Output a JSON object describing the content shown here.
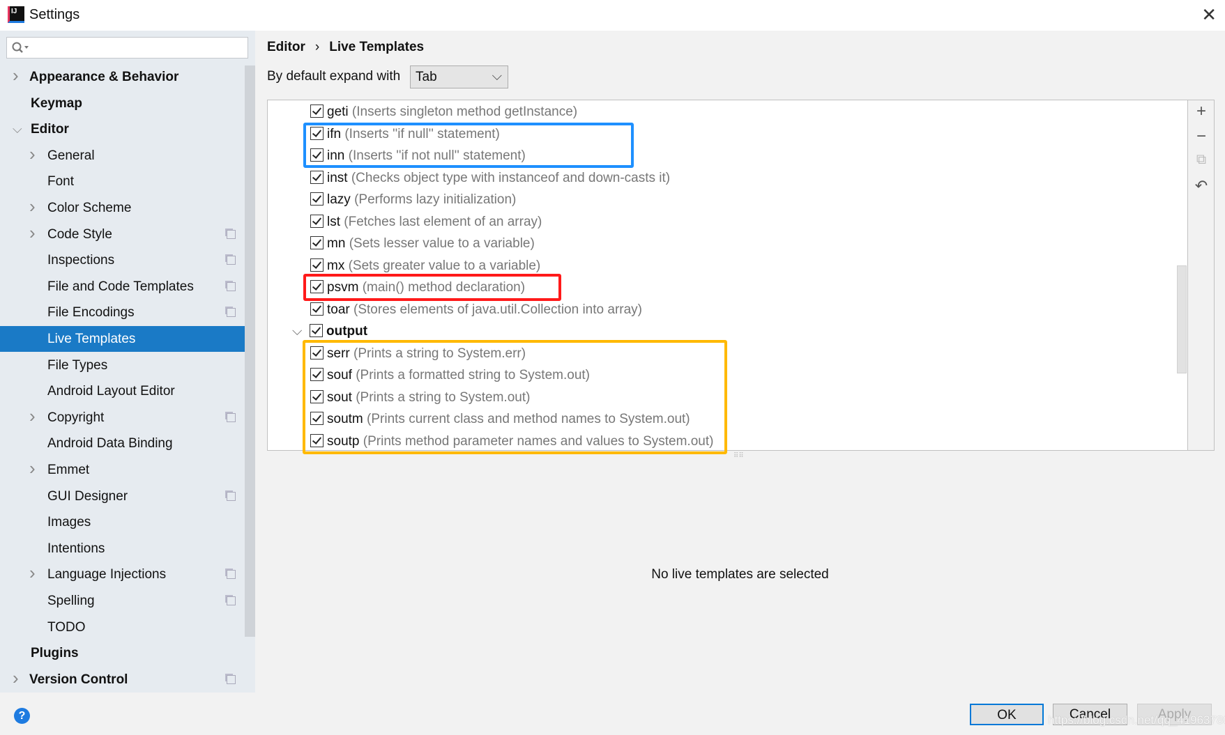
{
  "window": {
    "title": "Settings",
    "close_icon": "close-icon"
  },
  "search": {
    "placeholder": ""
  },
  "sidebar": {
    "items": [
      {
        "label": "Appearance & Behavior",
        "level": 0,
        "chevron": "right",
        "bold": true
      },
      {
        "label": "Keymap",
        "level": 0,
        "bold": true
      },
      {
        "label": "Editor",
        "level": 0,
        "chevron": "down",
        "bold": true
      },
      {
        "label": "General",
        "level": 1,
        "chevron": "right"
      },
      {
        "label": "Font",
        "level": 1
      },
      {
        "label": "Color Scheme",
        "level": 1,
        "chevron": "right"
      },
      {
        "label": "Code Style",
        "level": 1,
        "chevron": "right",
        "project": true
      },
      {
        "label": "Inspections",
        "level": 1,
        "project": true
      },
      {
        "label": "File and Code Templates",
        "level": 1,
        "project": true
      },
      {
        "label": "File Encodings",
        "level": 1,
        "project": true
      },
      {
        "label": "Live Templates",
        "level": 1,
        "selected": true
      },
      {
        "label": "File Types",
        "level": 1
      },
      {
        "label": "Android Layout Editor",
        "level": 1
      },
      {
        "label": "Copyright",
        "level": 1,
        "chevron": "right",
        "project": true
      },
      {
        "label": "Android Data Binding",
        "level": 1
      },
      {
        "label": "Emmet",
        "level": 1,
        "chevron": "right"
      },
      {
        "label": "GUI Designer",
        "level": 1,
        "project": true
      },
      {
        "label": "Images",
        "level": 1
      },
      {
        "label": "Intentions",
        "level": 1
      },
      {
        "label": "Language Injections",
        "level": 1,
        "chevron": "right",
        "project": true
      },
      {
        "label": "Spelling",
        "level": 1,
        "project": true
      },
      {
        "label": "TODO",
        "level": 1
      },
      {
        "label": "Plugins",
        "level": 0,
        "bold": true
      },
      {
        "label": "Version Control",
        "level": 0,
        "chevron": "right",
        "bold": true,
        "project": true
      }
    ]
  },
  "breadcrumb": [
    "Editor",
    "Live Templates"
  ],
  "expand": {
    "label": "By default expand with",
    "value": "Tab"
  },
  "templates": [
    {
      "abbr": "geti",
      "desc": "(Inserts singleton method getInstance)",
      "checked": true
    },
    {
      "abbr": "ifn",
      "desc": "(Inserts ''if null'' statement)",
      "checked": true
    },
    {
      "abbr": "inn",
      "desc": "(Inserts ''if not null'' statement)",
      "checked": true
    },
    {
      "abbr": "inst",
      "desc": "(Checks object type with instanceof and down-casts it)",
      "checked": true
    },
    {
      "abbr": "lazy",
      "desc": "(Performs lazy initialization)",
      "checked": true
    },
    {
      "abbr": "lst",
      "desc": "(Fetches last element of an array)",
      "checked": true
    },
    {
      "abbr": "mn",
      "desc": "(Sets lesser value to a variable)",
      "checked": true
    },
    {
      "abbr": "mx",
      "desc": "(Sets greater value to a variable)",
      "checked": true
    },
    {
      "abbr": "psvm",
      "desc": "(main() method declaration)",
      "checked": true
    },
    {
      "abbr": "toar",
      "desc": "(Stores elements of java.util.Collection into array)",
      "checked": true
    },
    {
      "group": "output",
      "checked": true,
      "expanded": true
    },
    {
      "abbr": "serr",
      "desc": "(Prints a string to System.err)",
      "checked": true
    },
    {
      "abbr": "souf",
      "desc": "(Prints a formatted string to System.out)",
      "checked": true
    },
    {
      "abbr": "sout",
      "desc": "(Prints a string to System.out)",
      "checked": true
    },
    {
      "abbr": "soutm",
      "desc": "(Prints current class and method names to System.out)",
      "checked": true
    },
    {
      "abbr": "soutp",
      "desc": "(Prints method parameter names and values to System.out)",
      "checked": true
    }
  ],
  "highlight_colors": {
    "blue": "#1e90ff",
    "red": "#ff1a1a",
    "orange": "#ffb900"
  },
  "toolbar": [
    "add-icon",
    "remove-icon",
    "copy-icon",
    "restore-icon"
  ],
  "empty_message": "No live templates are selected",
  "buttons": {
    "ok": "OK",
    "cancel": "Cancel",
    "apply": "Apply"
  },
  "watermark": "https://blog.csdn.net/qq_41963780"
}
